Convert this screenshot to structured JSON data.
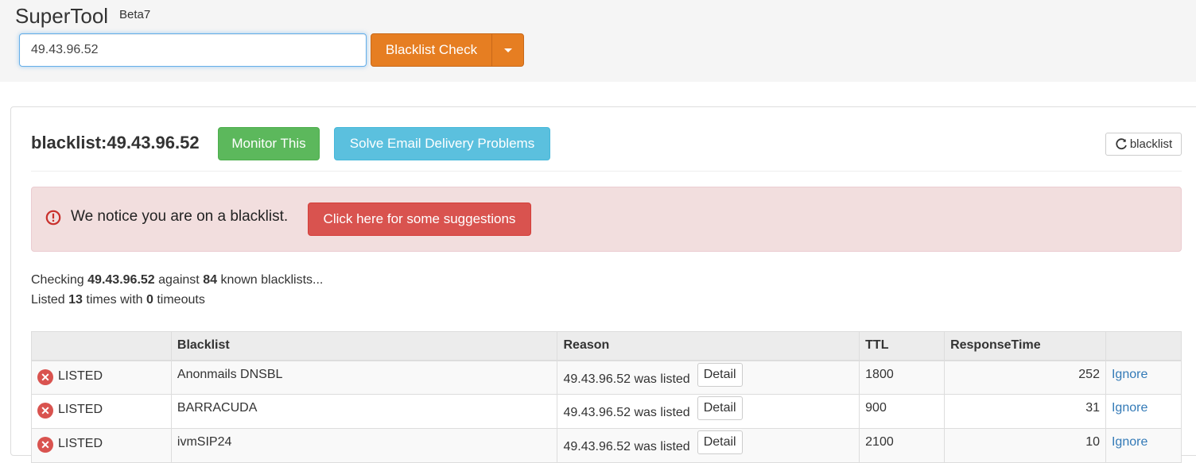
{
  "header": {
    "brand": "SuperTool",
    "version": "Beta7",
    "search_value": "49.43.96.52",
    "action_label": "Blacklist Check"
  },
  "result": {
    "title": "blacklist:49.43.96.52",
    "monitor_label": "Monitor This",
    "solve_label": "Solve Email Delivery Problems",
    "refresh_label": "blacklist"
  },
  "alert": {
    "message": "We notice you are on a blacklist.",
    "button_label": "Click here for some suggestions"
  },
  "summary": {
    "line1_prefix": "Checking",
    "ip": "49.43.96.52",
    "line1_mid": "against",
    "count": "84",
    "line1_suffix": "known blacklists...",
    "line2_prefix": "Listed",
    "listed_times": "13",
    "line2_mid": "times with",
    "timeouts": "0",
    "line2_suffix": "timeouts"
  },
  "table": {
    "headers": [
      "",
      "Blacklist",
      "Reason",
      "TTL",
      "ResponseTime",
      ""
    ],
    "rows": [
      {
        "status": "LISTED",
        "blacklist": "Anonmails DNSBL",
        "reason": "49.43.96.52 was listed",
        "detail": "Detail",
        "ttl": "1800",
        "response": "252",
        "action": "Ignore"
      },
      {
        "status": "LISTED",
        "blacklist": "BARRACUDA",
        "reason": "49.43.96.52 was listed",
        "detail": "Detail",
        "ttl": "900",
        "response": "31",
        "action": "Ignore"
      },
      {
        "status": "LISTED",
        "blacklist": "ivmSIP24",
        "reason": "49.43.96.52 was listed",
        "detail": "Detail",
        "ttl": "2100",
        "response": "10",
        "action": "Ignore"
      }
    ]
  },
  "colors": {
    "orange": "#e67e22",
    "green": "#5cb85c",
    "info": "#5bc0de",
    "danger": "#d9534f",
    "alert_bg": "#f2dede",
    "link": "#337ab7"
  },
  "icons": {
    "refresh": "refresh-icon",
    "alert": "exclamation-circle-icon",
    "listed": "x-circle-icon",
    "dropdown": "caret-down-icon"
  }
}
